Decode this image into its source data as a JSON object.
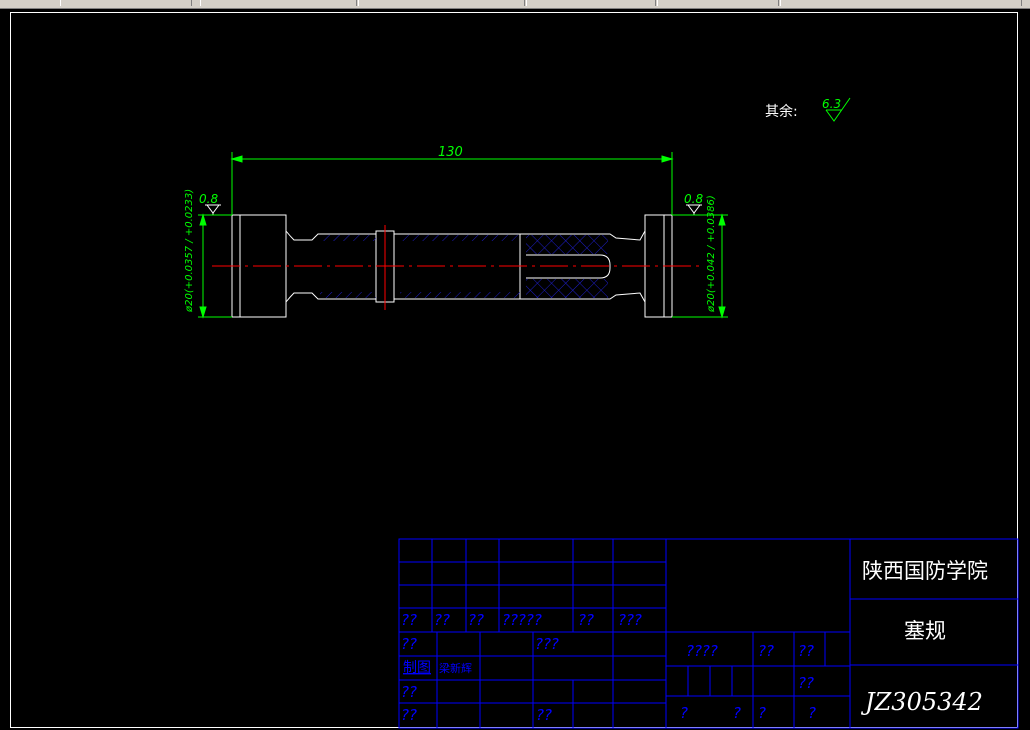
{
  "window": {
    "tabs": [
      "",
      "",
      "",
      "",
      "",
      ""
    ]
  },
  "drawing": {
    "roughness_note_label": "其余:",
    "roughness_note_value": "6.3",
    "overall_length": "130",
    "left_roughness": "0.8",
    "right_roughness": "0.8",
    "left_diameter": "ø20(+0.0357 / +0.0233)",
    "right_diameter": "ø20(+0.042 / +0.0386)"
  },
  "title_block": {
    "school": "陕西国防学院",
    "part_name": "塞规",
    "drawing_number": "JZ305342",
    "drawn_by_label": "制图",
    "drawn_by_name": "梁新辉",
    "cells": {
      "r3": [
        "??",
        "??",
        "??",
        "?????",
        "??",
        "???"
      ],
      "r4a": "??",
      "r4b": "???",
      "r4c": "????",
      "r4d": "??",
      "r4e": "??",
      "r5": "??",
      "r6": "??",
      "r6b": "??",
      "bottom": [
        "?",
        "?",
        "?",
        "?"
      ]
    }
  },
  "colors": {
    "outline": "#ffffff",
    "dimension": "#00ff00",
    "centerline": "#ff0000",
    "hatch": "#1e1ec8",
    "title_block_lines": "#0000ff"
  }
}
